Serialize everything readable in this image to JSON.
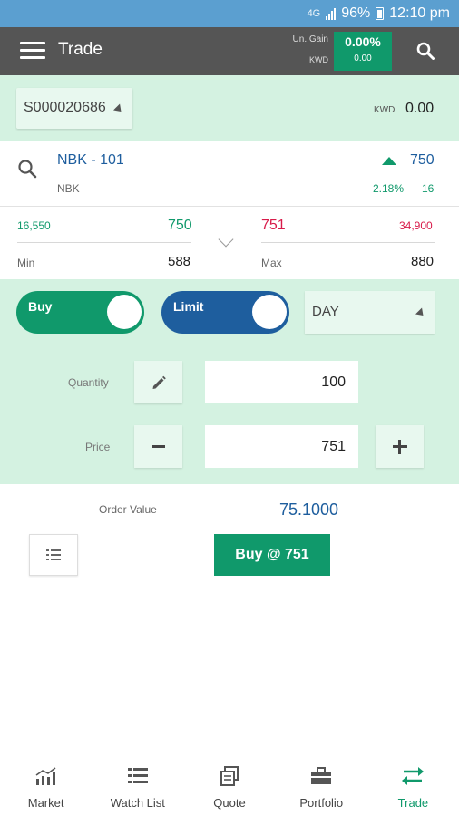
{
  "status_bar": {
    "network": "4G",
    "battery": "96%",
    "time": "12:10 pm"
  },
  "app_bar": {
    "title": "Trade",
    "unrealized_gain_label": "Un. Gain",
    "currency_label": "KWD",
    "gain_percent": "0.00%",
    "gain_value": "0.00"
  },
  "account": {
    "id": "S000020686",
    "currency": "KWD",
    "balance": "0.00"
  },
  "symbol": {
    "name": "NBK - 101",
    "short_name": "NBK",
    "last_price": "750",
    "change_percent": "2.18%",
    "change": "16",
    "trend": "up"
  },
  "depth": {
    "bid_qty": "16,550",
    "bid_price": "750",
    "ask_price": "751",
    "ask_qty": "34,900",
    "min_label": "Min",
    "min_value": "588",
    "max_label": "Max",
    "max_value": "880"
  },
  "order_form": {
    "side": "Buy",
    "order_type": "Limit",
    "validity": "DAY",
    "quantity_label": "Quantity",
    "quantity": "100",
    "price_label": "Price",
    "price": "751"
  },
  "order_summary": {
    "order_value_label": "Order Value",
    "order_value": "75.1000",
    "submit_label": "Buy @ 751"
  },
  "nav": {
    "items": [
      {
        "label": "Market",
        "icon": "market-chart-icon"
      },
      {
        "label": "Watch List",
        "icon": "watch-list-icon"
      },
      {
        "label": "Quote",
        "icon": "quote-icon"
      },
      {
        "label": "Portfolio",
        "icon": "portfolio-briefcase-icon"
      },
      {
        "label": "Trade",
        "icon": "trade-arrows-icon",
        "active": true
      }
    ]
  },
  "colors": {
    "status_bar": "#5b9fd0",
    "app_bar": "#555555",
    "accent_green": "#10996b",
    "accent_blue": "#1e5e9e",
    "ask_red": "#d81b4a",
    "panel_green": "#d4f2e1"
  }
}
